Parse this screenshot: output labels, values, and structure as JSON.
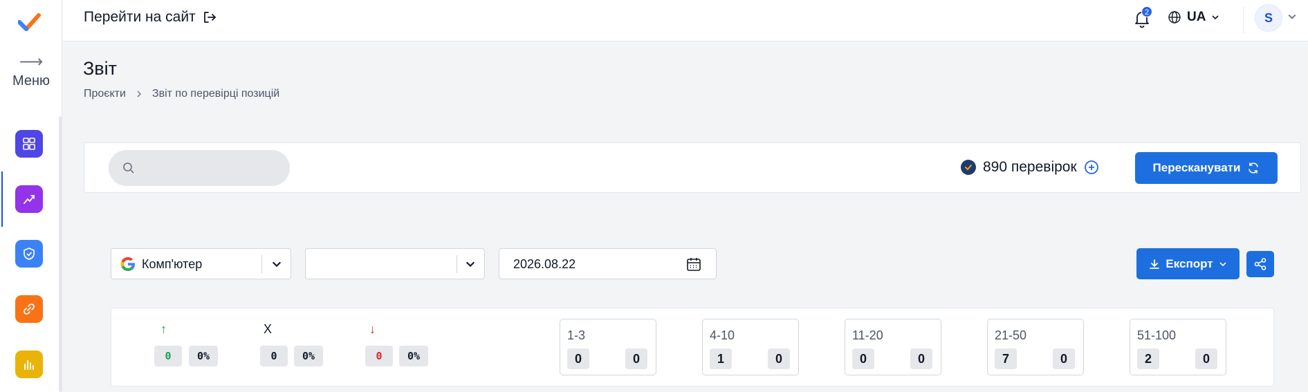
{
  "sidebar": {
    "menu_label": "Меню",
    "items": [
      {
        "icon": "dashboard-icon",
        "color": "#4f46e5"
      },
      {
        "icon": "trend-chart-icon",
        "color": "#9333ea"
      },
      {
        "icon": "shield-check-icon",
        "color": "#3b82f6"
      },
      {
        "icon": "link-icon",
        "color": "#f97316"
      },
      {
        "icon": "bar-chart-icon",
        "color": "#eab308"
      }
    ]
  },
  "topbar": {
    "goto_site": "Перейти на сайт",
    "notifications_count": "2",
    "language": "UA",
    "avatar_initial": "S"
  },
  "page": {
    "title": "Звіт",
    "breadcrumb": [
      "Проєкти",
      "Звіт по перевірці позицій"
    ]
  },
  "search": {
    "placeholder": "",
    "checks_text": "890 перевірок",
    "rescan_label": "Пересканувати"
  },
  "filters": {
    "device": "Комп'ютер",
    "second_select": "",
    "date": "2026.08.22",
    "export_label": "Експорт"
  },
  "stats": {
    "trends": [
      {
        "symbol": "↑",
        "color": "#16a34a",
        "count": "0",
        "percent": "0%"
      },
      {
        "symbol": "X",
        "color": "#111827",
        "count": "0",
        "percent": "0%"
      },
      {
        "symbol": "↓",
        "color": "#dc2626",
        "count": "0",
        "percent": "0%"
      }
    ],
    "ranges": [
      {
        "label": "1-3",
        "a": "0",
        "b": "0"
      },
      {
        "label": "4-10",
        "a": "1",
        "b": "0"
      },
      {
        "label": "11-20",
        "a": "0",
        "b": "0"
      },
      {
        "label": "21-50",
        "a": "7",
        "b": "0"
      },
      {
        "label": "51-100",
        "a": "2",
        "b": "0"
      }
    ]
  }
}
